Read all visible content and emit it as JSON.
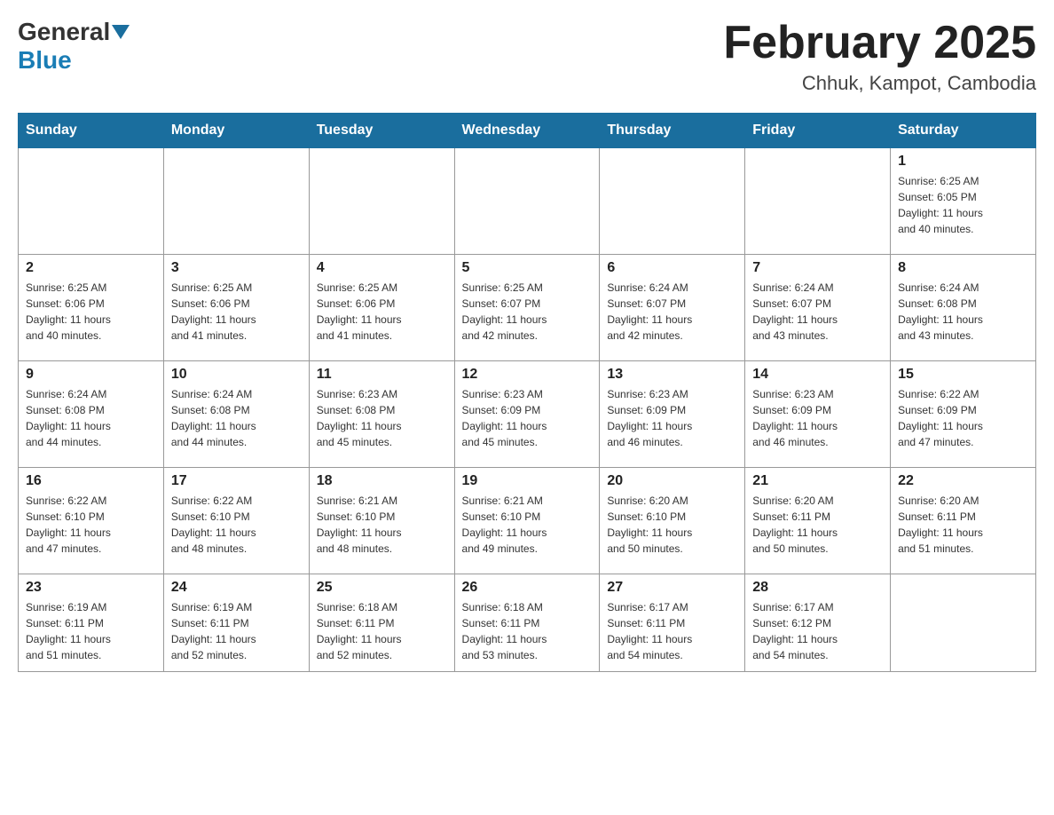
{
  "header": {
    "logo_general": "General",
    "logo_blue": "Blue",
    "month_title": "February 2025",
    "location": "Chhuk, Kampot, Cambodia"
  },
  "weekdays": [
    "Sunday",
    "Monday",
    "Tuesday",
    "Wednesday",
    "Thursday",
    "Friday",
    "Saturday"
  ],
  "weeks": [
    [
      {
        "day": "",
        "info": ""
      },
      {
        "day": "",
        "info": ""
      },
      {
        "day": "",
        "info": ""
      },
      {
        "day": "",
        "info": ""
      },
      {
        "day": "",
        "info": ""
      },
      {
        "day": "",
        "info": ""
      },
      {
        "day": "1",
        "info": "Sunrise: 6:25 AM\nSunset: 6:05 PM\nDaylight: 11 hours\nand 40 minutes."
      }
    ],
    [
      {
        "day": "2",
        "info": "Sunrise: 6:25 AM\nSunset: 6:06 PM\nDaylight: 11 hours\nand 40 minutes."
      },
      {
        "day": "3",
        "info": "Sunrise: 6:25 AM\nSunset: 6:06 PM\nDaylight: 11 hours\nand 41 minutes."
      },
      {
        "day": "4",
        "info": "Sunrise: 6:25 AM\nSunset: 6:06 PM\nDaylight: 11 hours\nand 41 minutes."
      },
      {
        "day": "5",
        "info": "Sunrise: 6:25 AM\nSunset: 6:07 PM\nDaylight: 11 hours\nand 42 minutes."
      },
      {
        "day": "6",
        "info": "Sunrise: 6:24 AM\nSunset: 6:07 PM\nDaylight: 11 hours\nand 42 minutes."
      },
      {
        "day": "7",
        "info": "Sunrise: 6:24 AM\nSunset: 6:07 PM\nDaylight: 11 hours\nand 43 minutes."
      },
      {
        "day": "8",
        "info": "Sunrise: 6:24 AM\nSunset: 6:08 PM\nDaylight: 11 hours\nand 43 minutes."
      }
    ],
    [
      {
        "day": "9",
        "info": "Sunrise: 6:24 AM\nSunset: 6:08 PM\nDaylight: 11 hours\nand 44 minutes."
      },
      {
        "day": "10",
        "info": "Sunrise: 6:24 AM\nSunset: 6:08 PM\nDaylight: 11 hours\nand 44 minutes."
      },
      {
        "day": "11",
        "info": "Sunrise: 6:23 AM\nSunset: 6:08 PM\nDaylight: 11 hours\nand 45 minutes."
      },
      {
        "day": "12",
        "info": "Sunrise: 6:23 AM\nSunset: 6:09 PM\nDaylight: 11 hours\nand 45 minutes."
      },
      {
        "day": "13",
        "info": "Sunrise: 6:23 AM\nSunset: 6:09 PM\nDaylight: 11 hours\nand 46 minutes."
      },
      {
        "day": "14",
        "info": "Sunrise: 6:23 AM\nSunset: 6:09 PM\nDaylight: 11 hours\nand 46 minutes."
      },
      {
        "day": "15",
        "info": "Sunrise: 6:22 AM\nSunset: 6:09 PM\nDaylight: 11 hours\nand 47 minutes."
      }
    ],
    [
      {
        "day": "16",
        "info": "Sunrise: 6:22 AM\nSunset: 6:10 PM\nDaylight: 11 hours\nand 47 minutes."
      },
      {
        "day": "17",
        "info": "Sunrise: 6:22 AM\nSunset: 6:10 PM\nDaylight: 11 hours\nand 48 minutes."
      },
      {
        "day": "18",
        "info": "Sunrise: 6:21 AM\nSunset: 6:10 PM\nDaylight: 11 hours\nand 48 minutes."
      },
      {
        "day": "19",
        "info": "Sunrise: 6:21 AM\nSunset: 6:10 PM\nDaylight: 11 hours\nand 49 minutes."
      },
      {
        "day": "20",
        "info": "Sunrise: 6:20 AM\nSunset: 6:10 PM\nDaylight: 11 hours\nand 50 minutes."
      },
      {
        "day": "21",
        "info": "Sunrise: 6:20 AM\nSunset: 6:11 PM\nDaylight: 11 hours\nand 50 minutes."
      },
      {
        "day": "22",
        "info": "Sunrise: 6:20 AM\nSunset: 6:11 PM\nDaylight: 11 hours\nand 51 minutes."
      }
    ],
    [
      {
        "day": "23",
        "info": "Sunrise: 6:19 AM\nSunset: 6:11 PM\nDaylight: 11 hours\nand 51 minutes."
      },
      {
        "day": "24",
        "info": "Sunrise: 6:19 AM\nSunset: 6:11 PM\nDaylight: 11 hours\nand 52 minutes."
      },
      {
        "day": "25",
        "info": "Sunrise: 6:18 AM\nSunset: 6:11 PM\nDaylight: 11 hours\nand 52 minutes."
      },
      {
        "day": "26",
        "info": "Sunrise: 6:18 AM\nSunset: 6:11 PM\nDaylight: 11 hours\nand 53 minutes."
      },
      {
        "day": "27",
        "info": "Sunrise: 6:17 AM\nSunset: 6:11 PM\nDaylight: 11 hours\nand 54 minutes."
      },
      {
        "day": "28",
        "info": "Sunrise: 6:17 AM\nSunset: 6:12 PM\nDaylight: 11 hours\nand 54 minutes."
      },
      {
        "day": "",
        "info": ""
      }
    ]
  ]
}
